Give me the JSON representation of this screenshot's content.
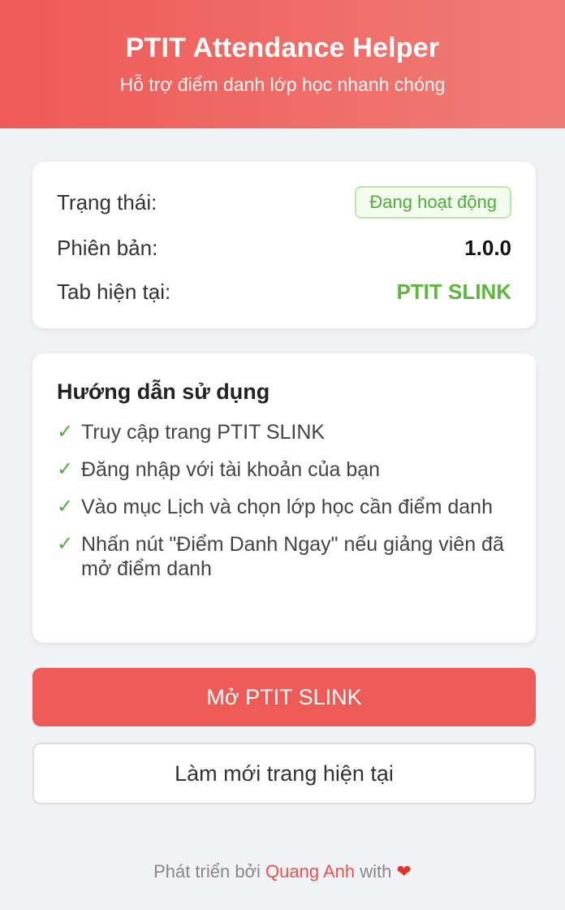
{
  "header": {
    "title": "PTIT Attendance Helper",
    "subtitle": "Hỗ trợ điểm danh lớp học nhanh chóng"
  },
  "status": {
    "state_label": "Trạng thái:",
    "state_value": "Đang hoạt động",
    "version_label": "Phiên bản:",
    "version_value": "1.0.0",
    "tab_label": "Tab hiện tại:",
    "tab_value": "PTIT SLINK"
  },
  "guide": {
    "title": "Hướng dẫn sử dụng",
    "steps": [
      "Truy cập trang PTIT SLINK",
      "Đăng nhập với tài khoản của bạn",
      "Vào mục Lịch và chọn lớp học cần điểm danh",
      "Nhấn nút \"Điểm Danh Ngay\" nếu giảng viên đã mở điểm danh"
    ],
    "check_icon": "✓"
  },
  "buttons": {
    "open": "Mở PTIT SLINK",
    "refresh": "Làm mới trang hiện tại"
  },
  "footer": {
    "prefix": "Phát triển bởi",
    "author": "Quang Anh",
    "suffix": "with",
    "heart": "❤"
  },
  "colors": {
    "accent": "#ee5a55",
    "success": "#4caf3a",
    "background": "#f1f2f6"
  }
}
